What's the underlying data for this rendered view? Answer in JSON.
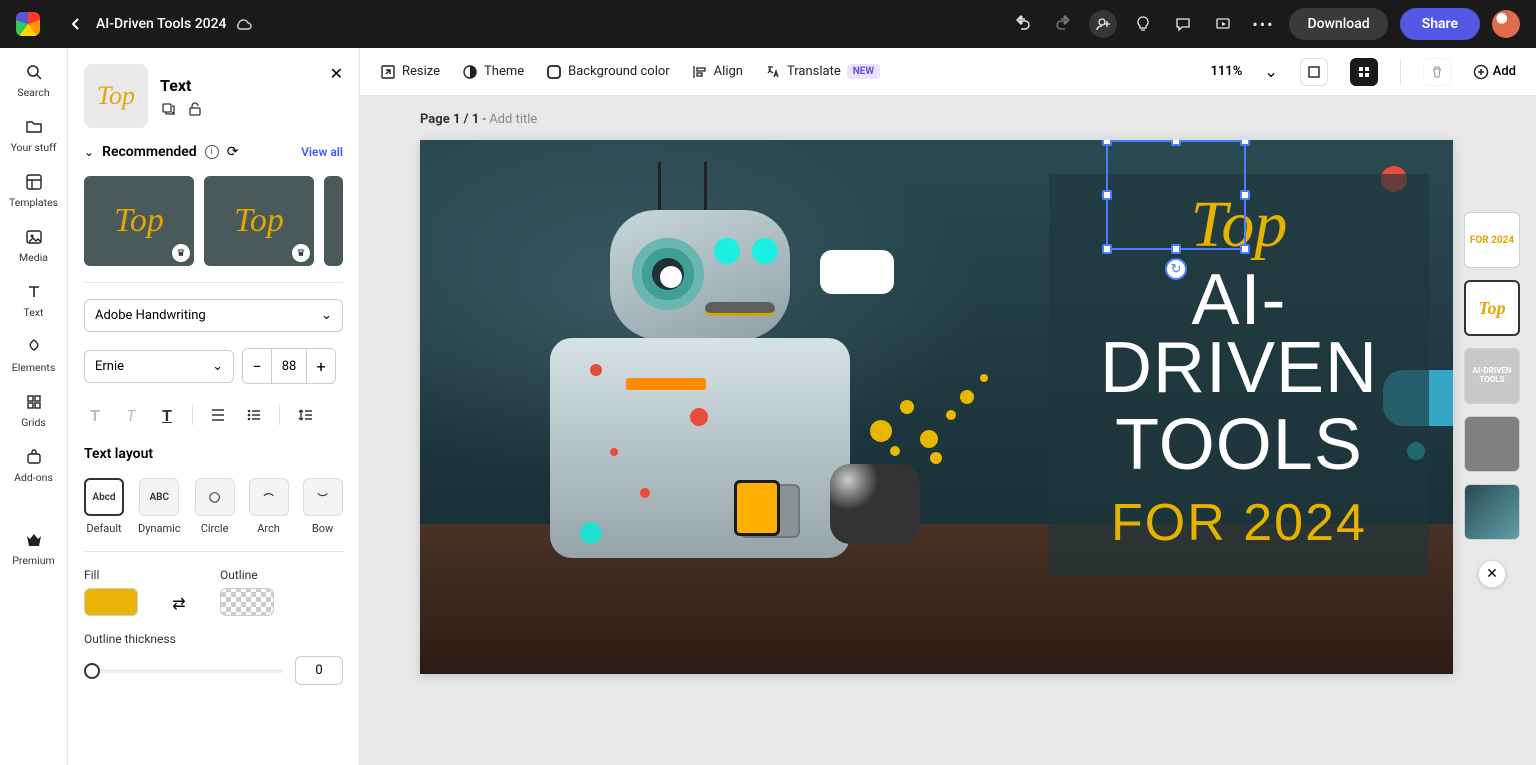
{
  "header": {
    "doc_title": "AI-Driven Tools 2024",
    "download": "Download",
    "share": "Share"
  },
  "rail": {
    "search": "Search",
    "your_stuff": "Your stuff",
    "templates": "Templates",
    "media": "Media",
    "text": "Text",
    "elements": "Elements",
    "grids": "Grids",
    "addons": "Add-ons",
    "premium": "Premium"
  },
  "panel": {
    "title": "Text",
    "thumb_text": "Top",
    "recommended": "Recommended",
    "view_all": "View all",
    "reco_items": [
      "Top",
      "Top"
    ],
    "font_family": "Adobe Handwriting",
    "font_style": "Ernie",
    "font_size": "88",
    "text_layout_title": "Text layout",
    "layouts": [
      {
        "key": "default",
        "label": "Default",
        "box": "Abcd"
      },
      {
        "key": "dynamic",
        "label": "Dynamic",
        "box": "ABC"
      },
      {
        "key": "circle",
        "label": "Circle",
        "box": "◯"
      },
      {
        "key": "arch",
        "label": "Arch",
        "box": "⌒"
      },
      {
        "key": "bow",
        "label": "Bow",
        "box": "︶"
      }
    ],
    "fill_label": "Fill",
    "outline_label": "Outline",
    "fill_color": "#EAB308",
    "outline_thickness_label": "Outline thickness",
    "outline_thickness": "0"
  },
  "toolbar": {
    "resize": "Resize",
    "theme": "Theme",
    "bg_color": "Background color",
    "align": "Align",
    "translate": "Translate",
    "new_badge": "NEW",
    "zoom": "111%",
    "add": "Add"
  },
  "page": {
    "prefix": "Page 1 / 1",
    "sep": " - ",
    "add_title": "Add title"
  },
  "artwork": {
    "top_word": "Top",
    "line1": "AI-DRIVEN",
    "line2": "TOOLS",
    "year": "FOR 2024"
  },
  "thumbs": {
    "t1": "FOR 2024",
    "t2": "Top",
    "t3": "AI-DRIVEN TOOLS"
  }
}
